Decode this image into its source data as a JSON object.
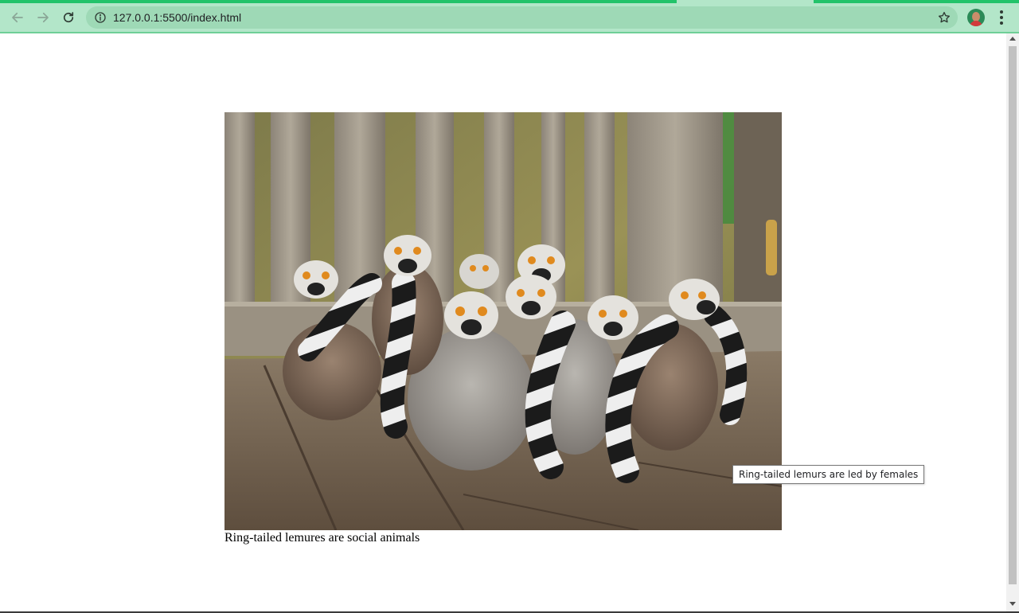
{
  "browser": {
    "url": "127.0.0.1:5500/index.html",
    "back_icon": "arrow-left-icon",
    "forward_icon": "arrow-right-icon",
    "reload_icon": "reload-icon",
    "info_icon": "info-circle-icon",
    "bookmark_icon": "star-outline-icon",
    "menu_icon": "vertical-dots-icon",
    "theme_color": "#b3e6c9",
    "progress_color": "#22c36a"
  },
  "page": {
    "image_alt": "Ring-tailed lemurs huddled together on a wooden bench",
    "caption": "Ring-tailed lemures are social animals",
    "tooltip": "Ring-tailed lemurs are led by females"
  }
}
